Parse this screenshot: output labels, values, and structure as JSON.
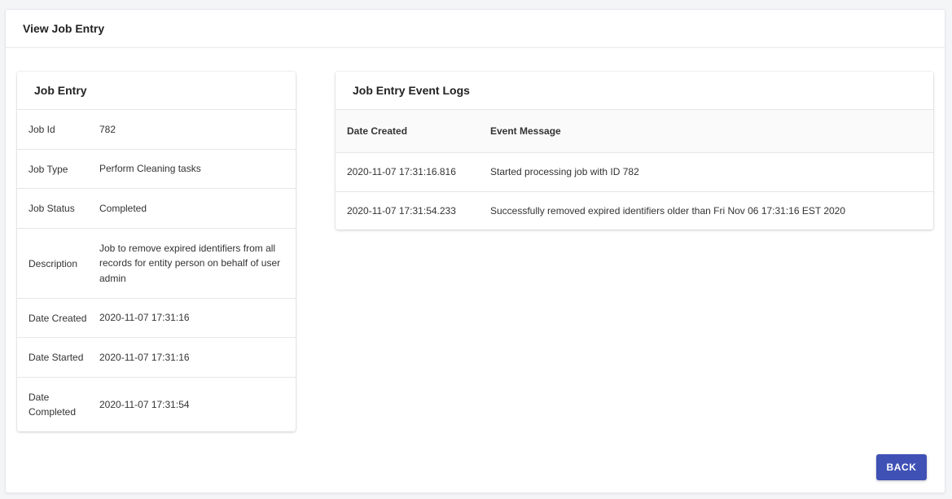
{
  "page": {
    "title": "View Job Entry"
  },
  "job_entry": {
    "title": "Job Entry",
    "fields": [
      {
        "label": "Job Id",
        "value": "782"
      },
      {
        "label": "Job Type",
        "value": "Perform Cleaning tasks"
      },
      {
        "label": "Job Status",
        "value": "Completed"
      },
      {
        "label": "Description",
        "value": "Job to remove expired identifiers from all records for entity person on behalf of user admin"
      },
      {
        "label": "Date Created",
        "value": "2020-11-07 17:31:16"
      },
      {
        "label": "Date Started",
        "value": "2020-11-07 17:31:16"
      },
      {
        "label": "Date Completed",
        "value": "2020-11-07 17:31:54"
      }
    ]
  },
  "event_logs": {
    "title": "Job Entry Event Logs",
    "columns": [
      "Date Created",
      "Event Message"
    ],
    "rows": [
      {
        "date": "2020-11-07 17:31:16.816",
        "message": "Started processing job with ID 782"
      },
      {
        "date": "2020-11-07 17:31:54.233",
        "message": "Successfully removed expired identifiers older than Fri Nov 06 17:31:16 EST 2020"
      }
    ]
  },
  "actions": {
    "back_label": "BACK"
  },
  "colors": {
    "primary": "#3f51b5"
  }
}
